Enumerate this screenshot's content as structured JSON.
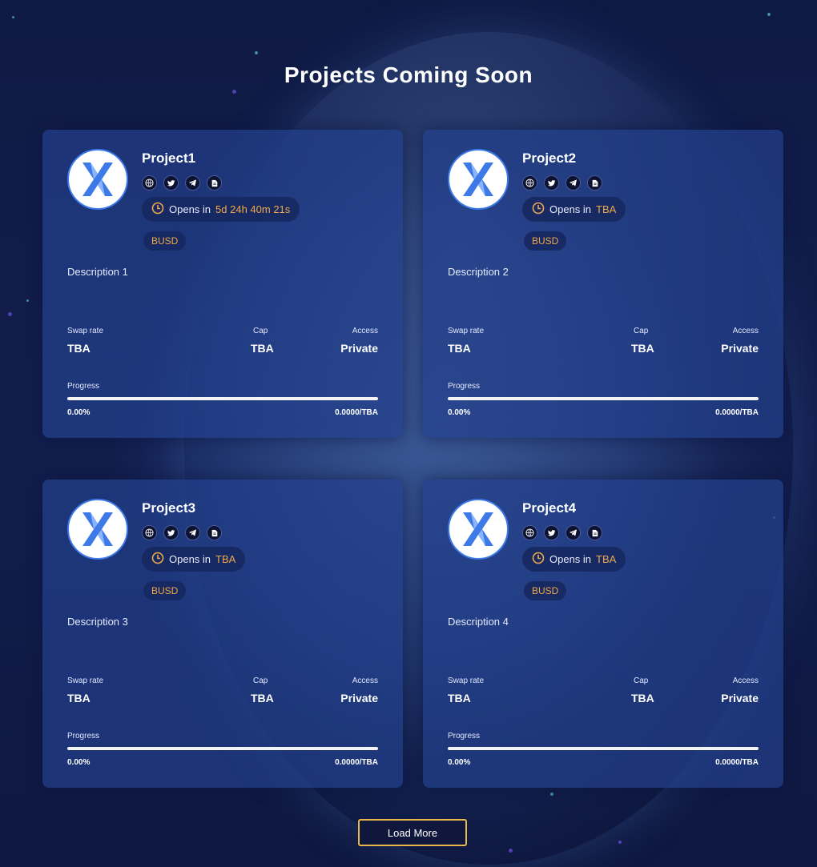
{
  "page": {
    "title": "Projects Coming Soon"
  },
  "projects": [
    {
      "name": "Project1",
      "opens_label": "Opens in",
      "opens_value": "5d 24h 40m 21s",
      "currency": "BUSD",
      "description": "Description 1",
      "swap_label": "Swap rate",
      "swap_value": "TBA",
      "cap_label": "Cap",
      "cap_value": "TBA",
      "access_label": "Access",
      "access_value": "Private",
      "progress_label": "Progress",
      "progress_percent": "0.00%",
      "progress_fraction": 0,
      "progress_amount": "0.0000/TBA"
    },
    {
      "name": "Project2",
      "opens_label": "Opens in",
      "opens_value": "TBA",
      "currency": "BUSD",
      "description": "Description 2",
      "swap_label": "Swap rate",
      "swap_value": "TBA",
      "cap_label": "Cap",
      "cap_value": "TBA",
      "access_label": "Access",
      "access_value": "Private",
      "progress_label": "Progress",
      "progress_percent": "0.00%",
      "progress_fraction": 0,
      "progress_amount": "0.0000/TBA"
    },
    {
      "name": "Project3",
      "opens_label": "Opens in",
      "opens_value": "TBA",
      "currency": "BUSD",
      "description": "Description 3",
      "swap_label": "Swap rate",
      "swap_value": "TBA",
      "cap_label": "Cap",
      "cap_value": "TBA",
      "access_label": "Access",
      "access_value": "Private",
      "progress_label": "Progress",
      "progress_percent": "0.00%",
      "progress_fraction": 0,
      "progress_amount": "0.0000/TBA"
    },
    {
      "name": "Project4",
      "opens_label": "Opens in",
      "opens_value": "TBA",
      "currency": "BUSD",
      "description": "Description 4",
      "swap_label": "Swap rate",
      "swap_value": "TBA",
      "cap_label": "Cap",
      "cap_value": "TBA",
      "access_label": "Access",
      "access_value": "Private",
      "progress_label": "Progress",
      "progress_percent": "0.00%",
      "progress_fraction": 0,
      "progress_amount": "0.0000/TBA"
    }
  ],
  "icons": {
    "social": [
      "globe-icon",
      "twitter-icon",
      "telegram-icon",
      "document-icon"
    ],
    "clock": "clock-icon",
    "logo": "x-logo-icon"
  },
  "load_more_label": "Load More",
  "colors": {
    "accent": "#f0a94a",
    "card": "#22408c",
    "background": "#0f1a44",
    "logo_blue": "#3d7ae8"
  }
}
